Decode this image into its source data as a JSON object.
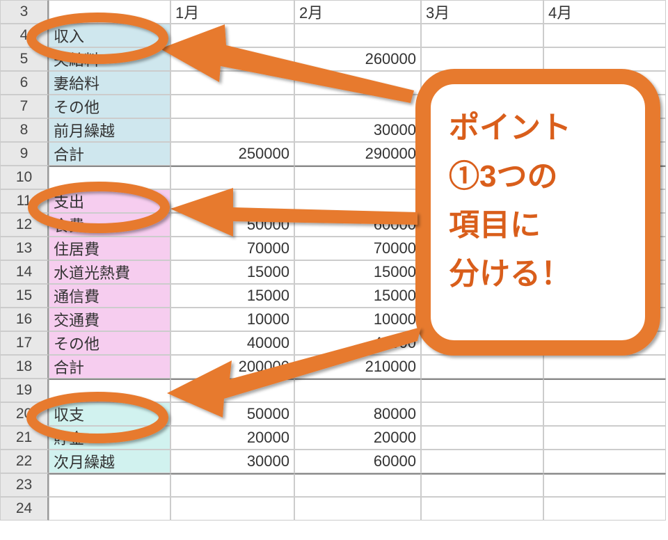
{
  "months": {
    "m1": "1月",
    "m2": "2月",
    "m3": "3月",
    "m4": "4月"
  },
  "rows": {
    "r3": {
      "n": "3"
    },
    "r4": {
      "n": "4",
      "a": "収入"
    },
    "r5": {
      "n": "5",
      "a": "夫給料",
      "c": "260000"
    },
    "r6": {
      "n": "6",
      "a": "妻給料"
    },
    "r7": {
      "n": "7",
      "a": "その他"
    },
    "r8": {
      "n": "8",
      "a": "前月繰越",
      "c": "30000"
    },
    "r9": {
      "n": "9",
      "a": "合計",
      "b": "250000",
      "c": "290000"
    },
    "r10": {
      "n": "10"
    },
    "r11": {
      "n": "11",
      "a": "支出"
    },
    "r12": {
      "n": "12",
      "a": "食費",
      "b": "50000",
      "c": "60000"
    },
    "r13": {
      "n": "13",
      "a": "住居費",
      "b": "70000",
      "c": "70000"
    },
    "r14": {
      "n": "14",
      "a": "水道光熱費",
      "b": "15000",
      "c": "15000"
    },
    "r15": {
      "n": "15",
      "a": "通信費",
      "b": "15000",
      "c": "15000"
    },
    "r16": {
      "n": "16",
      "a": "交通費",
      "b": "10000",
      "c": "10000"
    },
    "r17": {
      "n": "17",
      "a": "その他",
      "b": "40000",
      "c": "40000"
    },
    "r18": {
      "n": "18",
      "a": "合計",
      "b": "200000",
      "c": "210000"
    },
    "r19": {
      "n": "19"
    },
    "r20": {
      "n": "20",
      "a": "収支",
      "b": "50000",
      "c": "80000"
    },
    "r21": {
      "n": "21",
      "a": "貯金",
      "b": "20000",
      "c": "20000"
    },
    "r22": {
      "n": "22",
      "a": "次月繰越",
      "b": "30000",
      "c": "60000"
    },
    "r23": {
      "n": "23"
    },
    "r24": {
      "n": "24"
    }
  },
  "callout": {
    "l1": "ポイント",
    "l2": "①3つの",
    "l3": "項目に",
    "l4": "分ける！"
  },
  "colors": {
    "accent": "#e77a2e",
    "accentDark": "#d95e1b"
  }
}
